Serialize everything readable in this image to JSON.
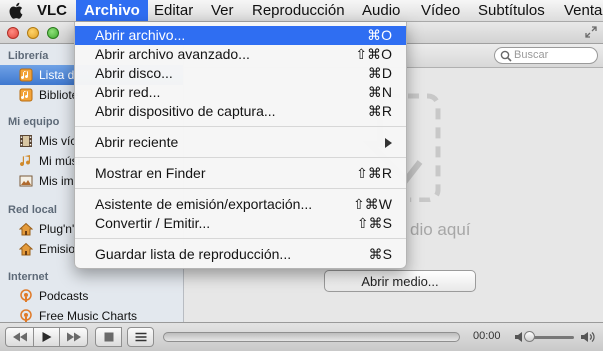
{
  "menubar": {
    "app": "VLC",
    "items": [
      "Archivo",
      "Editar",
      "Ver",
      "Reproducción",
      "Audio",
      "Vídeo",
      "Subtítulos",
      "Venta"
    ]
  },
  "sidebar": {
    "sections": [
      {
        "title": "Librería",
        "items": [
          {
            "label": "Lista d"
          },
          {
            "label": "Bibliote"
          }
        ]
      },
      {
        "title": "Mi equipo",
        "items": [
          {
            "label": "Mis víc"
          },
          {
            "label": "Mi músi"
          },
          {
            "label": "Mis im"
          }
        ]
      },
      {
        "title": "Red local",
        "items": [
          {
            "label": "Plug'n'"
          },
          {
            "label": "Emisio"
          }
        ]
      },
      {
        "title": "Internet",
        "items": [
          {
            "label": "Podcasts"
          },
          {
            "label": "Free Music Charts"
          }
        ]
      }
    ]
  },
  "search": {
    "placeholder": "Buscar"
  },
  "main": {
    "drop_text": "dio aquí",
    "open_media_label": "Abrir medio..."
  },
  "controls": {
    "time": "00:00"
  },
  "file_menu": {
    "items": [
      {
        "label": "Abrir archivo...",
        "shortcut": "⌘O",
        "highlighted": true
      },
      {
        "label": "Abrir archivo avanzado...",
        "shortcut": "⇧⌘O"
      },
      {
        "label": "Abrir disco...",
        "shortcut": "⌘D"
      },
      {
        "label": "Abrir red...",
        "shortcut": "⌘N"
      },
      {
        "label": "Abrir dispositivo de captura...",
        "shortcut": "⌘R"
      },
      {
        "label": "Abrir reciente",
        "submenu": true
      },
      {
        "label": "Mostrar en Finder",
        "shortcut": "⇧⌘R"
      },
      {
        "label": "Asistente de emisión/exportación...",
        "shortcut": "⇧⌘W"
      },
      {
        "label": "Convertir / Emitir...",
        "shortcut": "⇧⌘S"
      },
      {
        "label": "Guardar lista de reproducción...",
        "shortcut": "⌘S"
      }
    ]
  },
  "colors": {
    "highlight": "#2f6ef2",
    "sidebar_bg": "#e3e8ee",
    "selection": "#3f78cf"
  }
}
